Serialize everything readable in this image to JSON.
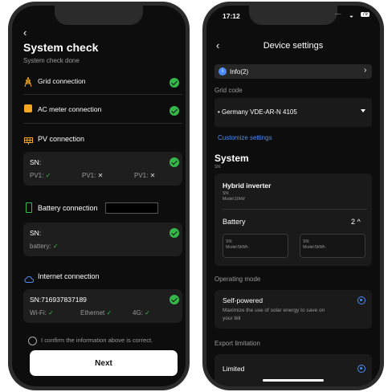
{
  "left_phone": {
    "back_icon": "chevron-left-icon",
    "title": "System check",
    "subtitle": "System check done",
    "grid_connection": "Grid connection",
    "ac_meter_connection": "AC meter connection",
    "pv_connection": "PV connection",
    "pv_sn": "SN:",
    "pv1": "PV1:",
    "pv2": "PV1:",
    "pv3": "PV1:",
    "battery_connection": "Battery connection",
    "battery_sn": "SN:",
    "battery_label": "battery:",
    "internet_connection": "Internet connection",
    "internet_sn": "SN:716937837189",
    "wifi": "Wi-Fi:",
    "ethernet": "Ethernet",
    "fourg": "4G:",
    "confirm_text": "I confirm the information above is correct.",
    "next_button": "Next",
    "check_mark": "✓",
    "cross_mark": "✕",
    "colors": {
      "success": "#35b84a",
      "warning": "#f5a623"
    }
  },
  "right_phone": {
    "status_time": "17:12",
    "status_signal": "....",
    "battery_status": "79",
    "title": "Device settings",
    "info_banner": "Info(2)",
    "grid_code_label": "Grid code",
    "grid_code_value": "• Germany VDE-AR-N 4105",
    "customize_link": "Customize settings",
    "system_heading": "System",
    "system_sn": "SN:",
    "hybrid_inverter": "Hybrid inverter",
    "hybrid_sn": "SN:",
    "hybrid_model": "Model:10kW",
    "battery_label": "Battery",
    "battery_count": "2",
    "battery_box1_sn": "SN:",
    "battery_box1_model": "Model:5kWh",
    "battery_box2_sn": "SN:",
    "battery_box2_model": "Model:5kWh",
    "operating_mode_label": "Operating mode",
    "self_powered_title": "Self-powered",
    "self_powered_desc_1": "Maximize the use of solar energy to save on",
    "self_powered_desc_2": "your bill",
    "export_limitation_label": "Export limitation",
    "limited_label": "Limited",
    "colors": {
      "accent": "#4c8df6",
      "error_dot": "#e53935"
    }
  }
}
